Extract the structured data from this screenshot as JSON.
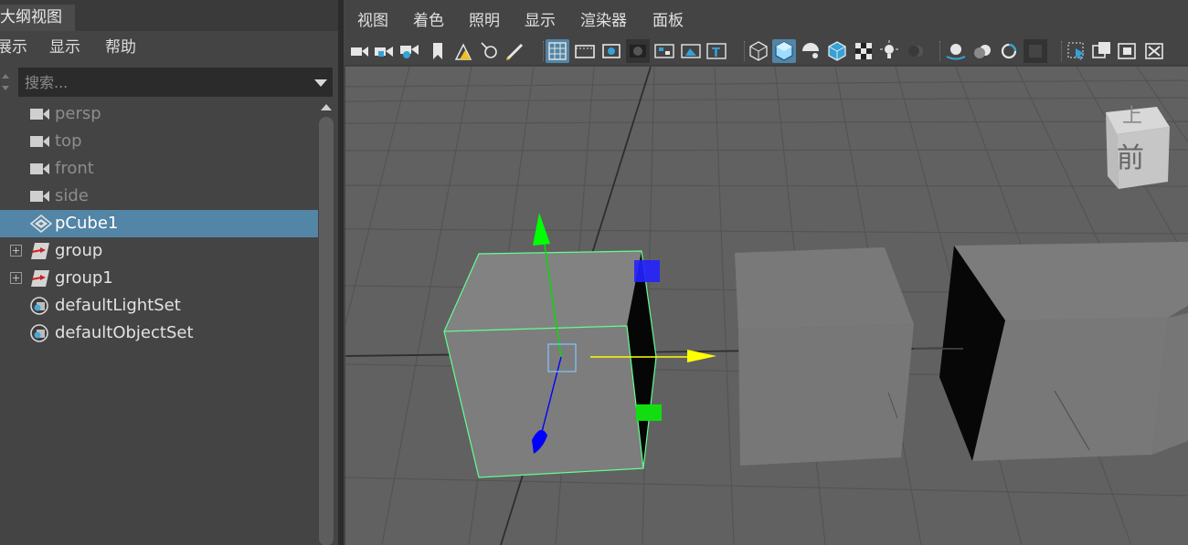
{
  "outliner": {
    "title": "大纲视图",
    "menu": [
      "展示",
      "显示",
      "帮助"
    ],
    "search": {
      "placeholder": "搜索..."
    },
    "items": [
      {
        "label": "persp",
        "icon": "camera-icon",
        "style": "dim",
        "selected": false,
        "expandable": false
      },
      {
        "label": "top",
        "icon": "camera-icon",
        "style": "dim",
        "selected": false,
        "expandable": false
      },
      {
        "label": "front",
        "icon": "camera-icon",
        "style": "dim",
        "selected": false,
        "expandable": false
      },
      {
        "label": "side",
        "icon": "camera-icon",
        "style": "dim",
        "selected": false,
        "expandable": false
      },
      {
        "label": "pCube1",
        "icon": "mesh-icon",
        "style": "normal",
        "selected": true,
        "expandable": false
      },
      {
        "label": "group",
        "icon": "group-transform-icon",
        "style": "normal",
        "selected": false,
        "expandable": true
      },
      {
        "label": "group1",
        "icon": "group-transform-icon",
        "style": "normal",
        "selected": false,
        "expandable": true
      },
      {
        "label": "defaultLightSet",
        "icon": "set-icon",
        "style": "normal",
        "selected": false,
        "expandable": false
      },
      {
        "label": "defaultObjectSet",
        "icon": "set-icon",
        "style": "normal",
        "selected": false,
        "expandable": false
      }
    ]
  },
  "viewport": {
    "menu": [
      "视图",
      "着色",
      "照明",
      "显示",
      "渲染器",
      "面板"
    ],
    "toolbar_icons": [
      "camera-select-icon",
      "lock-camera-icon",
      "camera-attributes-icon",
      "bookmark-icon",
      "image-plane-icon",
      "two-d-pan-icon",
      "grease-pencil-icon",
      "grid-icon",
      "film-gate-icon",
      "resolution-gate-icon",
      "gate-mask-icon",
      "field-chart-icon",
      "safe-action-icon",
      "safe-title-icon",
      "wireframe-icon",
      "smooth-shade-icon",
      "default-material-icon",
      "wireframe-on-shaded-icon",
      "textured-icon",
      "use-lights-icon",
      "shadows-icon",
      "screen-space-ao-icon",
      "motion-blur-icon",
      "anti-aliasing-icon",
      "depth-of-field-icon",
      "isolate-select-icon",
      "xray-icon",
      "xray-joints-icon",
      "xray-components-icon"
    ],
    "view_cube": {
      "top_label": "上",
      "front_label": "前"
    },
    "colors": {
      "selection_highlight": "#5285a6",
      "viewport_background": "#616161",
      "gizmo_x": "#ffff00",
      "gizmo_y": "#00ff00",
      "gizmo_z": "#0000ff",
      "selection_wire": "#62ff8f"
    }
  }
}
